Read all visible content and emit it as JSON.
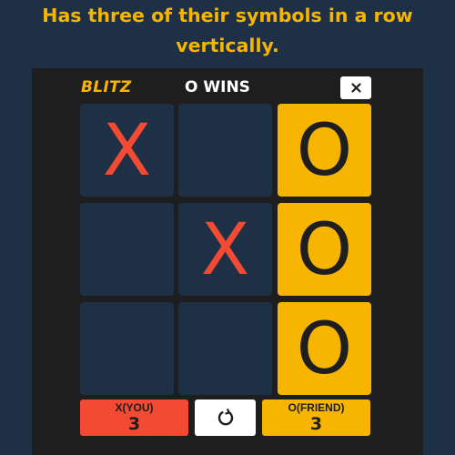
{
  "caption": {
    "line1": "Has three of their symbols in a row",
    "line2": "vertically."
  },
  "header": {
    "mode": "BLITZ",
    "status": "O WINS",
    "close_icon": "close-icon"
  },
  "board": {
    "cells": [
      {
        "mark": "X",
        "winning": false
      },
      {
        "mark": "",
        "winning": false
      },
      {
        "mark": "O",
        "winning": true
      },
      {
        "mark": "",
        "winning": false
      },
      {
        "mark": "X",
        "winning": false
      },
      {
        "mark": "O",
        "winning": true
      },
      {
        "mark": "",
        "winning": false
      },
      {
        "mark": "",
        "winning": false
      },
      {
        "mark": "O",
        "winning": true
      }
    ]
  },
  "footer": {
    "player_x": {
      "label": "X(YOU)",
      "score": "3"
    },
    "player_o": {
      "label": "O(FRIEND)",
      "score": "3"
    },
    "restart_icon": "restart-icon"
  },
  "colors": {
    "background": "#1d3045",
    "panel": "#1e1e1e",
    "accent_yellow": "#f7b500",
    "accent_red": "#f24a33",
    "white": "#ffffff"
  }
}
